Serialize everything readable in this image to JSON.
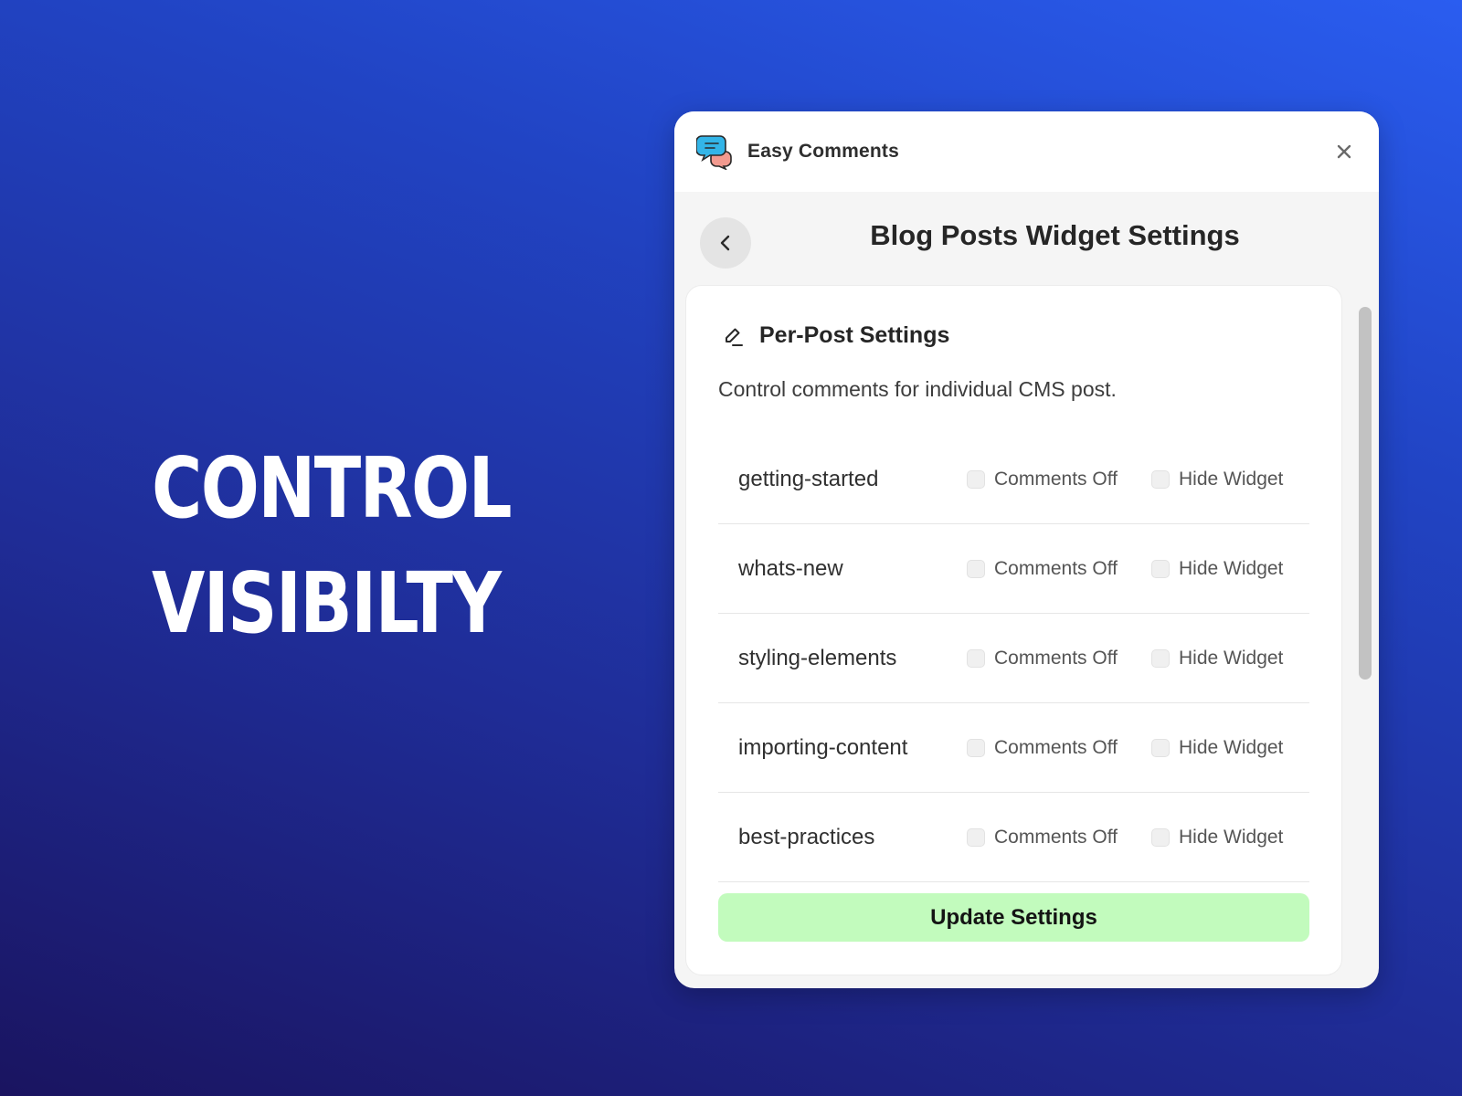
{
  "headline": {
    "line1": "CONTROL",
    "line2": "VISIBILTY"
  },
  "window": {
    "app_title": "Easy Comments",
    "app_icon": "chat-bubbles-icon",
    "close_icon": "close-icon"
  },
  "page": {
    "title": "Blog Posts Widget Settings",
    "back_icon": "chevron-left-icon"
  },
  "section": {
    "icon": "pencil-icon",
    "title": "Per-Post Settings",
    "description": "Control comments for individual CMS post."
  },
  "posts": [
    {
      "slug": "getting-started",
      "option1": "Comments Off",
      "option2": "Hide Widget"
    },
    {
      "slug": "whats-new",
      "option1": "Comments Off",
      "option2": "Hide Widget"
    },
    {
      "slug": "styling-elements",
      "option1": "Comments Off",
      "option2": "Hide Widget"
    },
    {
      "slug": "importing-content",
      "option1": "Comments Off",
      "option2": "Hide Widget"
    },
    {
      "slug": "best-practices",
      "option1": "Comments Off",
      "option2": "Hide Widget"
    }
  ],
  "update_button": "Update Settings",
  "colors": {
    "update_button_bg": "#c2fbbd",
    "background_top": "#2a5df0",
    "background_bottom": "#1a1460"
  }
}
